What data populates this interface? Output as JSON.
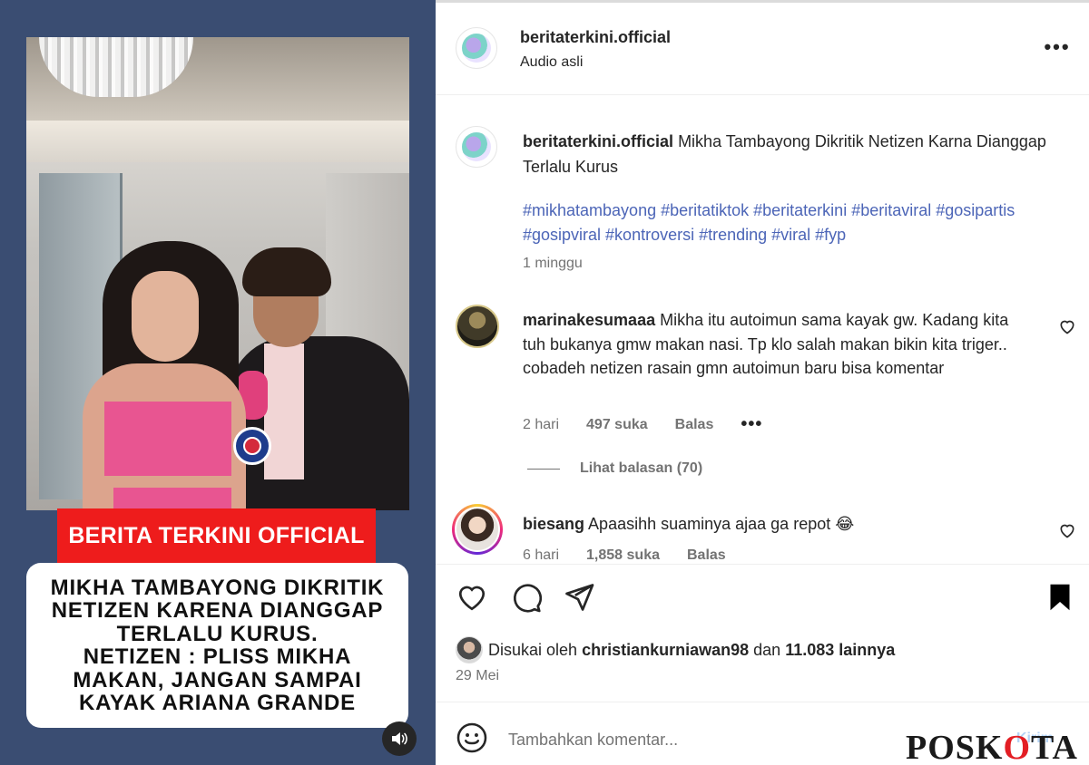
{
  "media": {
    "brand_bar": "BERITA TERKINI OFFICIAL",
    "headline": "MIKHA TAMBAYONG DIKRITIK\nNETIZEN KARENA DIANGGAP\nTERLALU KURUS.\nNETIZEN : PLISS MIKHA\nMAKAN, JANGAN SAMPAI\nKAYAK ARIANA GRANDE",
    "audio_icon": "speaker-icon"
  },
  "header": {
    "username": "beritaterkini.official",
    "audio": "Audio asli",
    "more_icon": "more-horizontal-icon",
    "more_text": "•••"
  },
  "caption": {
    "username": "beritaterkini.official",
    "text": "Mikha Tambayong Dikritik Netizen Karna Dianggap Terlalu Kurus",
    "tags": "#mikhatambayong #beritatiktok #beritaterkini #beritaviral #gosipartis #gosipviral #kontroversi #trending #viral #fyp",
    "time": "1 minggu"
  },
  "comments": [
    {
      "username": "marinakesumaaa",
      "text": "Mikha itu autoimun sama kayak gw. Kadang kita tuh bukanya gmw makan nasi. Tp klo salah makan bikin kita triger.. cobadeh netizen rasain gmn autoimun baru bisa komentar",
      "time": "2 hari",
      "likes": "497 suka",
      "reply": "Balas",
      "more": "•••",
      "view_replies": "Lihat balasan (70)"
    },
    {
      "username": "biesang",
      "text": "Apaasihh suaminya ajaa ga repot 😂",
      "time": "6 hari",
      "likes": "1,858 suka",
      "reply": "Balas"
    }
  ],
  "actions": {
    "liked_prefix": "Disukai oleh ",
    "liked_user": "christiankurniawan98",
    "liked_mid": " dan ",
    "liked_count": "11.083 lainnya",
    "date": "29 Mei"
  },
  "composer": {
    "placeholder": "Tambahkan komentar...",
    "send": "Kirim"
  },
  "watermark": {
    "pre": "POSK",
    "accent": "O",
    "post": "TA"
  },
  "colors": {
    "hashtag": "#4c65b7",
    "brand_red": "#ee1c1c",
    "media_bg": "#3a4d72"
  }
}
